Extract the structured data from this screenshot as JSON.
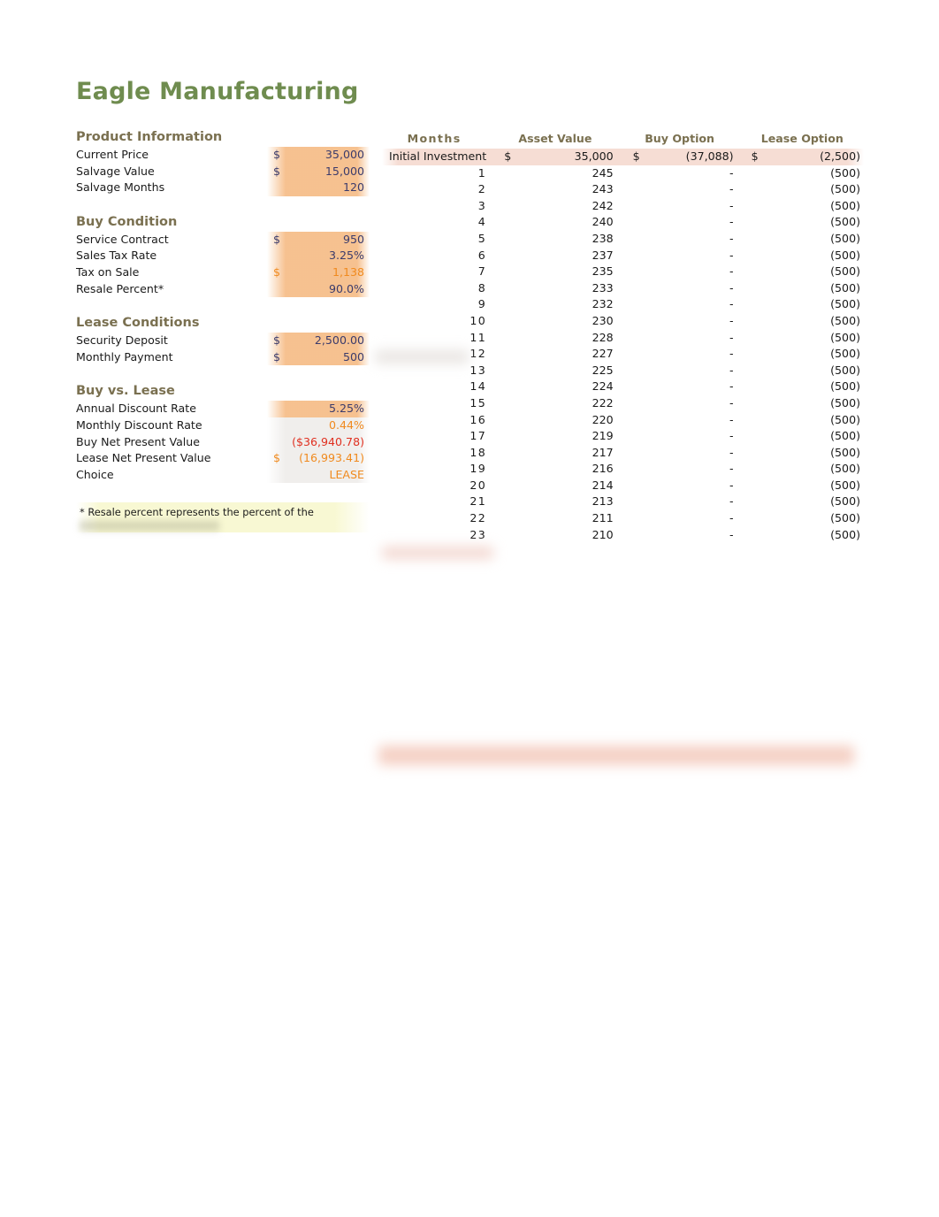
{
  "document": {
    "title": "Eagle Manufacturing"
  },
  "left_panel": {
    "sections": [
      {
        "heading": "Product Information",
        "rows": [
          {
            "label": "Current Price",
            "currency": "$",
            "value": "35,000",
            "fill": "orange",
            "value_color": "blue"
          },
          {
            "label": "Salvage Value",
            "currency": "$",
            "value": "15,000",
            "fill": "orange",
            "value_color": "blue"
          },
          {
            "label": "Salvage Months",
            "currency": "",
            "value": "120",
            "fill": "orange",
            "value_color": "blue"
          }
        ]
      },
      {
        "heading": "Buy Condition",
        "rows": [
          {
            "label": "Service Contract",
            "currency": "$",
            "value": "950",
            "fill": "orange",
            "value_color": "blue"
          },
          {
            "label": "Sales Tax Rate",
            "currency": "",
            "value": "3.25%",
            "fill": "orange",
            "value_color": "blue"
          },
          {
            "label": "Tax on Sale",
            "currency": "$",
            "value": "1,138",
            "fill": "orange",
            "value_color": "orange"
          },
          {
            "label": "Resale Percent*",
            "currency": "",
            "value": "90.0%",
            "fill": "orange",
            "value_color": "blue"
          }
        ]
      },
      {
        "heading": "Lease Conditions",
        "rows": [
          {
            "label": "Security Deposit",
            "currency": "$",
            "value": "2,500.00",
            "fill": "orange",
            "value_color": "blue"
          },
          {
            "label": "Monthly Payment",
            "currency": "$",
            "value": "500",
            "fill": "orange",
            "value_color": "blue"
          }
        ]
      },
      {
        "heading": "Buy vs. Lease",
        "rows": [
          {
            "label": "Annual Discount Rate",
            "currency": "",
            "value": "5.25%",
            "fill": "orange",
            "value_color": "blue"
          },
          {
            "label": "Monthly Discount Rate",
            "currency": "",
            "value": "0.44%",
            "fill": "grey",
            "value_color": "orange"
          },
          {
            "label": "Buy Net Present Value",
            "currency": "",
            "value": "($36,940.78)",
            "fill": "grey",
            "value_color": "red"
          },
          {
            "label": "Lease Net Present Value",
            "currency": "$",
            "value": "(16,993.41)",
            "fill": "grey",
            "value_color": "orange"
          },
          {
            "label": "Choice",
            "currency": "",
            "value": "LEASE",
            "fill": "grey",
            "value_color": "orange"
          }
        ]
      }
    ],
    "footnote": "* Resale percent represents the percent of the"
  },
  "schedule_table": {
    "columns": [
      "Months",
      "Asset Value",
      "Buy Option",
      "Lease Option"
    ],
    "initial_row": {
      "label": "Initial Investment",
      "asset_currency": "$",
      "asset_value": "35,000",
      "buy_currency": "$",
      "buy_value": "(37,088)",
      "lease_currency": "$",
      "lease_value": "(2,500)"
    },
    "rows": [
      {
        "month": "1",
        "asset": "245",
        "buy": "-",
        "lease": "(500)"
      },
      {
        "month": "2",
        "asset": "243",
        "buy": "-",
        "lease": "(500)"
      },
      {
        "month": "3",
        "asset": "242",
        "buy": "-",
        "lease": "(500)"
      },
      {
        "month": "4",
        "asset": "240",
        "buy": "-",
        "lease": "(500)"
      },
      {
        "month": "5",
        "asset": "238",
        "buy": "-",
        "lease": "(500)"
      },
      {
        "month": "6",
        "asset": "237",
        "buy": "-",
        "lease": "(500)"
      },
      {
        "month": "7",
        "asset": "235",
        "buy": "-",
        "lease": "(500)"
      },
      {
        "month": "8",
        "asset": "233",
        "buy": "-",
        "lease": "(500)"
      },
      {
        "month": "9",
        "asset": "232",
        "buy": "-",
        "lease": "(500)"
      },
      {
        "month": "10",
        "asset": "230",
        "buy": "-",
        "lease": "(500)"
      },
      {
        "month": "11",
        "asset": "228",
        "buy": "-",
        "lease": "(500)"
      },
      {
        "month": "12",
        "asset": "227",
        "buy": "-",
        "lease": "(500)"
      },
      {
        "month": "13",
        "asset": "225",
        "buy": "-",
        "lease": "(500)"
      },
      {
        "month": "14",
        "asset": "224",
        "buy": "-",
        "lease": "(500)"
      },
      {
        "month": "15",
        "asset": "222",
        "buy": "-",
        "lease": "(500)"
      },
      {
        "month": "16",
        "asset": "220",
        "buy": "-",
        "lease": "(500)"
      },
      {
        "month": "17",
        "asset": "219",
        "buy": "-",
        "lease": "(500)"
      },
      {
        "month": "18",
        "asset": "217",
        "buy": "-",
        "lease": "(500)"
      },
      {
        "month": "19",
        "asset": "216",
        "buy": "-",
        "lease": "(500)"
      },
      {
        "month": "20",
        "asset": "214",
        "buy": "-",
        "lease": "(500)"
      },
      {
        "month": "21",
        "asset": "213",
        "buy": "-",
        "lease": "(500)"
      },
      {
        "month": "22",
        "asset": "211",
        "buy": "-",
        "lease": "(500)"
      },
      {
        "month": "23",
        "asset": "210",
        "buy": "-",
        "lease": "(500)"
      }
    ]
  },
  "colors": {
    "title_green": "#6f8c4f",
    "section_heading": "#7a7050",
    "input_fill": "#f6be8a",
    "calc_fill": "#eeecea",
    "header_row_fill": "#f6ddd4",
    "value_blue": "#3b3b6b",
    "value_orange": "#f08a1e",
    "value_red": "#e03020",
    "note_fill": "#f7f7cb"
  }
}
